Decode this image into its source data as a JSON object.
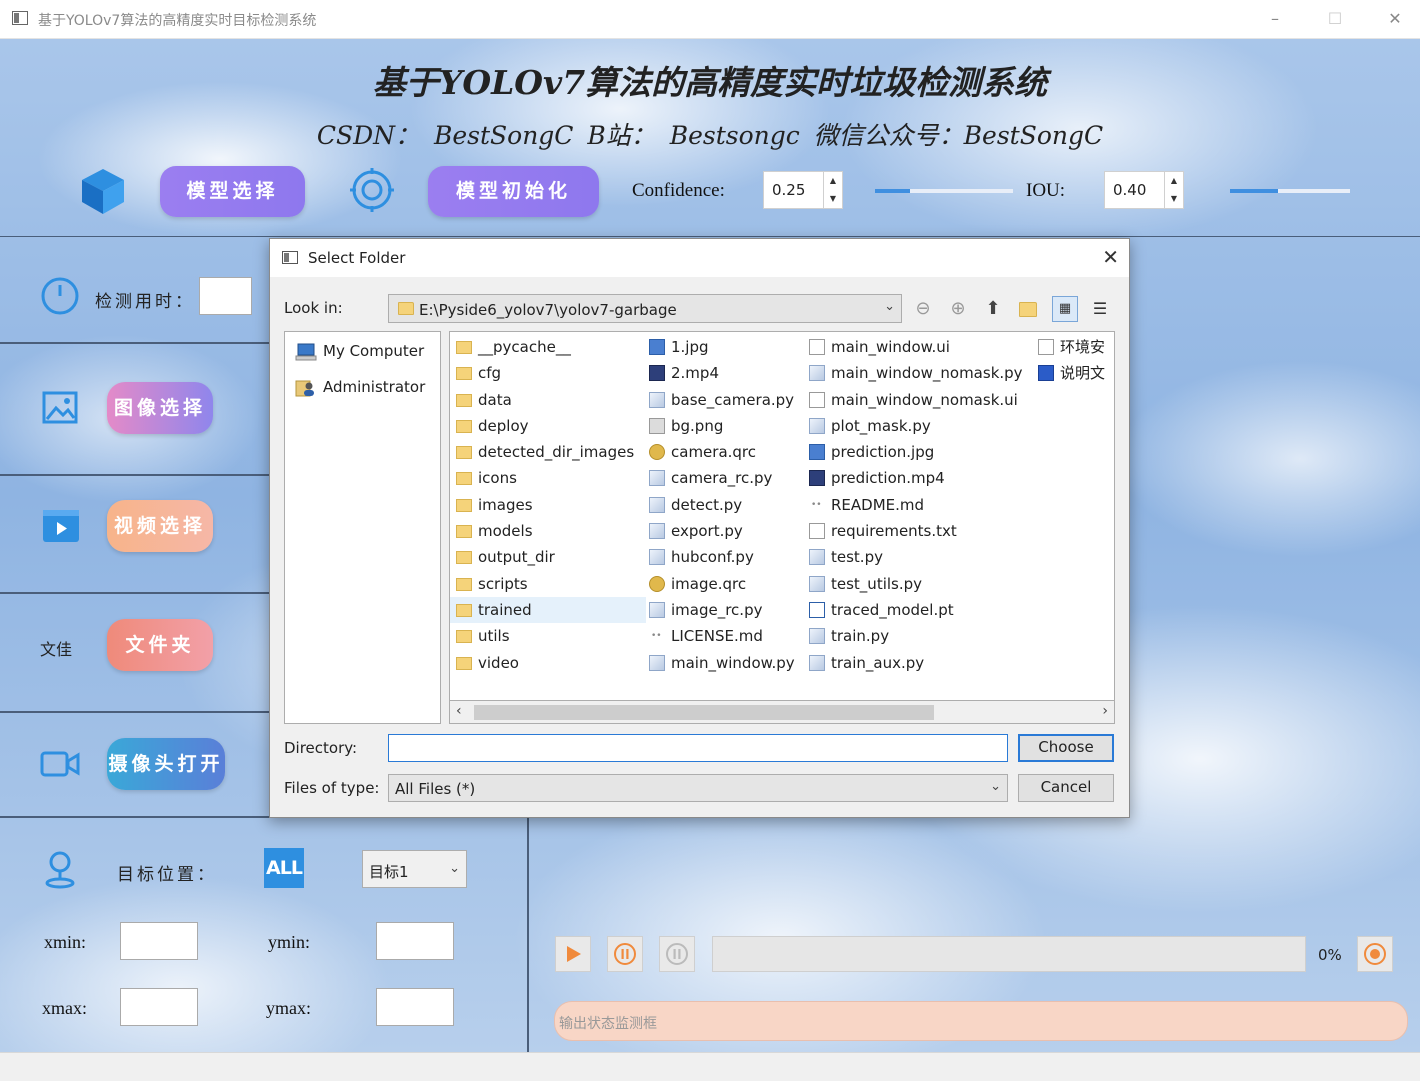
{
  "window": {
    "title": "基于YOLOv7算法的高精度实时目标检测系统",
    "controls": {
      "minimize": "–",
      "maximize": "☐",
      "close": "✕"
    }
  },
  "header": {
    "title": "基于YOLOv7算法的高精度实时垃圾检测系统",
    "subtitle": "CSDN： BestSongC   B站： Bestsongc    微信公众号：BestSongC"
  },
  "toolbar": {
    "model_select_label": "模型选择",
    "model_init_label": "模型初始化",
    "confidence_label": "Confidence:",
    "confidence_value": "0.25",
    "confidence_slider_fraction": 0.25,
    "iou_label": "IOU:",
    "iou_value": "0.40",
    "iou_slider_fraction": 0.4
  },
  "left_panel": {
    "detect_time_label": "检测用时：",
    "image_select_label": "图像选择",
    "video_select_label": "视频选择",
    "folder_label_small": "文佳",
    "folder_button_label": "文件夹",
    "camera_open_label": "摄像头打开",
    "target_position_label": "目标位置：",
    "all_badge": "ALL",
    "target_select_value": "目标1",
    "xmin_label": "xmin:",
    "ymin_label": "ymin:",
    "xmax_label": "xmax:",
    "ymax_label": "ymax:"
  },
  "playback": {
    "progress_text": "0%",
    "progress_fraction": 0,
    "status_placeholder": "输出状态监测框"
  },
  "dialog": {
    "title": "Select Folder",
    "look_in_label": "Look in:",
    "look_in_path": "E:\\Pyside6_yolov7\\yolov7-garbage",
    "places": [
      {
        "label": "My Computer",
        "icon": "computer-icon"
      },
      {
        "label": "Administrator",
        "icon": "user-icon"
      }
    ],
    "columns": [
      [
        {
          "name": "__pycache__",
          "icon": "folder"
        },
        {
          "name": "cfg",
          "icon": "folder"
        },
        {
          "name": "data",
          "icon": "folder"
        },
        {
          "name": "deploy",
          "icon": "folder"
        },
        {
          "name": "detected_dir_images",
          "icon": "folder"
        },
        {
          "name": "icons",
          "icon": "folder"
        },
        {
          "name": "images",
          "icon": "folder"
        },
        {
          "name": "models",
          "icon": "folder"
        },
        {
          "name": "output_dir",
          "icon": "folder"
        },
        {
          "name": "scripts",
          "icon": "folder"
        },
        {
          "name": "trained",
          "icon": "folder",
          "selected": true
        },
        {
          "name": "utils",
          "icon": "folder"
        },
        {
          "name": "video",
          "icon": "folder"
        }
      ],
      [
        {
          "name": "1.jpg",
          "icon": "img"
        },
        {
          "name": "2.mp4",
          "icon": "mp4"
        },
        {
          "name": "base_camera.py",
          "icon": "py"
        },
        {
          "name": "bg.png",
          "icon": "png"
        },
        {
          "name": "camera.qrc",
          "icon": "qrc"
        },
        {
          "name": "camera_rc.py",
          "icon": "py"
        },
        {
          "name": "detect.py",
          "icon": "py"
        },
        {
          "name": "export.py",
          "icon": "py"
        },
        {
          "name": "hubconf.py",
          "icon": "py"
        },
        {
          "name": "image.qrc",
          "icon": "qrc"
        },
        {
          "name": "image_rc.py",
          "icon": "py"
        },
        {
          "name": "LICENSE.md",
          "icon": "md"
        },
        {
          "name": "main_window.py",
          "icon": "py"
        }
      ],
      [
        {
          "name": "main_window.ui",
          "icon": "doc"
        },
        {
          "name": "main_window_nomask.py",
          "icon": "py"
        },
        {
          "name": "main_window_nomask.ui",
          "icon": "doc"
        },
        {
          "name": "plot_mask.py",
          "icon": "py"
        },
        {
          "name": "prediction.jpg",
          "icon": "img"
        },
        {
          "name": "prediction.mp4",
          "icon": "mp4"
        },
        {
          "name": "README.md",
          "icon": "md"
        },
        {
          "name": "requirements.txt",
          "icon": "doc"
        },
        {
          "name": "test.py",
          "icon": "py"
        },
        {
          "name": "test_utils.py",
          "icon": "py"
        },
        {
          "name": "traced_model.pt",
          "icon": "pt"
        },
        {
          "name": "train.py",
          "icon": "py"
        },
        {
          "name": "train_aux.py",
          "icon": "py"
        }
      ],
      [
        {
          "name": "环境安",
          "icon": "doc"
        },
        {
          "name": "说明文",
          "icon": "word"
        }
      ]
    ],
    "directory_label": "Directory:",
    "directory_value": "",
    "choose_label": "Choose",
    "files_of_type_label": "Files of type:",
    "files_of_type_value": "All Files (*)",
    "cancel_label": "Cancel"
  },
  "colors": {
    "accent_purple": "#9b7ef0",
    "accent_blue": "#3f8fe0",
    "status_fill": "#f8d6c6",
    "control_orange": "#f08a3c"
  }
}
